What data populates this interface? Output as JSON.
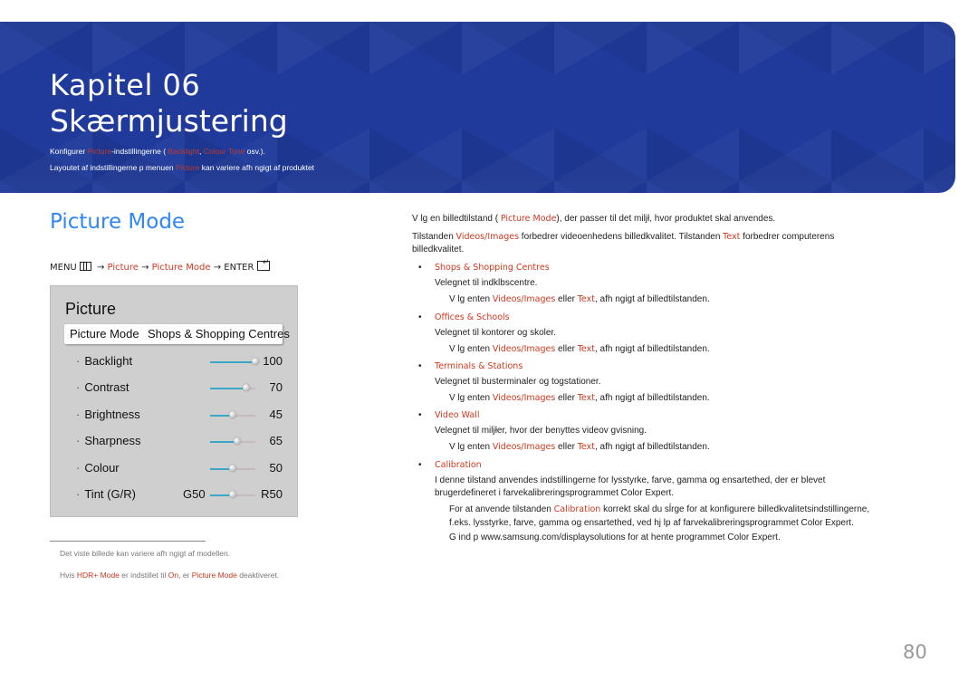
{
  "banner": {
    "chapter": "Kapitel 06",
    "title": "Skærmjustering",
    "line1": {
      "pre": "Konfigurer ",
      "h1": "Picture",
      "mid1": "-indstillingerne ( ",
      "h2": "Backlight",
      "mid2": ", ",
      "h3": "Colour Tone",
      "post": " osv.)."
    },
    "line2": {
      "pre": "Layoutet af indstillingerne p  menuen  ",
      "h1": "Picture",
      "post": " kan variere afh ngigt af produktet"
    }
  },
  "section": {
    "title": "Picture Mode",
    "menu_path": {
      "menu": "MENU",
      "arrow": "→",
      "p1": "Picture",
      "p2": "Picture Mode",
      "enter": "ENTER"
    }
  },
  "osd": {
    "title": "Picture",
    "selected": {
      "label": "Picture Mode",
      "value": "Shops & Shopping Centres"
    },
    "settings": [
      {
        "label": "Backlight",
        "value": "100",
        "level": 1.0
      },
      {
        "label": "Contrast",
        "value": "70",
        "level": 0.8
      },
      {
        "label": "Brightness",
        "value": "45",
        "level": 0.5
      },
      {
        "label": "Sharpness",
        "value": "65",
        "level": 0.6
      },
      {
        "label": "Colour",
        "value": "50",
        "level": 0.5
      },
      {
        "label": "Tint (G/R)",
        "left_value": "G50",
        "value": "R50",
        "level": 0.5
      }
    ]
  },
  "footnotes": {
    "note1": "Det viste billede kan variere afh ngigt af modellen.",
    "note2": {
      "pre": "Hvis ",
      "h1": "HDR+ Mode",
      "mid1": " er indstillet til  ",
      "h2": "On",
      "mid2": ", er ",
      "h3": "Picture Mode",
      "post": " deaktiveret."
    }
  },
  "right": {
    "intro": {
      "pre": "V lg en billedtilstand (  ",
      "h1": "Picture Mode",
      "post": "), der passer til det miljł, hvor produktet skal anvendes."
    },
    "para2": {
      "pre": "Tilstanden ",
      "h1": "Videos/Images",
      "mid": " forbedrer videoenhedens billedkvalitet. Tilstanden  ",
      "h2": "Text",
      "post": " forbedrer computerens",
      "line2": "billedkvalitet."
    },
    "select_note": {
      "pre": "V lg enten   ",
      "h1": "Videos/Images",
      "mid": " eller ",
      "h2": "Text",
      "post": ", afh ngigt af billedtilstanden."
    },
    "bullets": [
      {
        "head": "Shops & Shopping Centres",
        "desc": "Velegnet til indklbscentre."
      },
      {
        "head": "Offices & Schools",
        "desc": "Velegnet til kontorer og skoler."
      },
      {
        "head": "Terminals & Stations",
        "desc": "Velegnet til busterminaler og togstationer."
      },
      {
        "head": "Video Wall",
        "desc": "Velegnet til miljłer, hvor der benyttes videov gvisning."
      },
      {
        "head": "Calibration",
        "desc1": "I denne tilstand anvendes indstillingerne for lysstyrke, farve, gamma og ensartethed, der er blevet",
        "desc2_pre": "brugerdefineret i farvekalibreringsprogrammet   ",
        "desc2_app": "Color Expert."
      }
    ],
    "calib_note": {
      "l1_pre": "For at anvende tilstanden ",
      "l1_h": "Calibration",
      "l1_post": " korrekt skal du sĺrge for at konfigurere billedkvalitetsindstillingerne,",
      "l2": "f.eks. lysstyrke, farve, gamma og ensartethed, ved hj lp af farvekalibreringsprogrammet   Color Expert.",
      "l3": "G  ind p  www.samsung.com/displaysolutions for at hente programmet   Color Expert."
    }
  },
  "page_number": "80"
}
